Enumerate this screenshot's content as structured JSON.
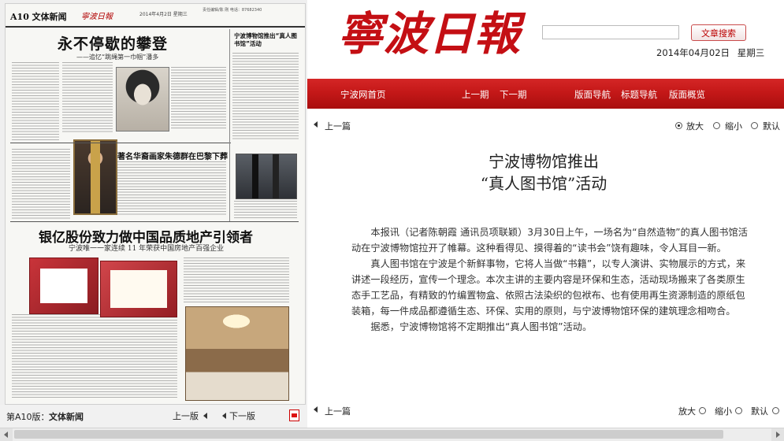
{
  "scan": {
    "section": "A10 文体新闻",
    "logo_mini": "寧波日報",
    "meta": "2014年4月2日 星期三",
    "meta2": "责任编辑/陈 刚  电话：87682340",
    "headline1": "永不停歇的攀登",
    "subhead1": "——追忆“跳绳第一巾帼”潘多",
    "headline_side": "宁波博物馆推出“真人图书馆”活动",
    "headline_mid": "著名华裔画家朱德群在巴黎下葬",
    "headline2": "银亿股份致力做中国品质地产引领者",
    "subhead2": "宁波唯一一家连续 11 年荣获中国房地产百强企业"
  },
  "left_footer": {
    "edition_prefix": "第A10版：",
    "edition_name": "文体新闻",
    "prev": "上一版",
    "next": "下一版"
  },
  "header": {
    "logo": "寧波日報",
    "search_placeholder": "",
    "search_button": "文章搜索",
    "date": "2014年04月02日",
    "weekday": "星期三"
  },
  "nav": {
    "home": "宁波网首页",
    "prev_issue": "上一期",
    "next_issue": "下一期",
    "page_nav": "版面导航",
    "title_nav": "标题导航",
    "overview": "版面概览"
  },
  "toolbar": {
    "prev_article": "上一篇",
    "zoom_in": "放大",
    "zoom_out": "缩小",
    "default": "默认",
    "selected": "zoom_in"
  },
  "toolbar_bottom": {
    "prev_article": "上一篇",
    "zoom_in": "放大",
    "zoom_out": "缩小",
    "default": "默认"
  },
  "article": {
    "title_line1": "宁波博物馆推出",
    "title_line2": "“真人图书馆”活动",
    "paragraphs": [
      "本报讯（记者陈朝霞 通讯员项联颖）3月30日上午，一场名为“自然造物”的真人图书馆活动在宁波博物馆拉开了帷幕。这种看得见、摸得着的“读书会”饶有趣味，令人耳目一新。",
      "真人图书馆在宁波是个新鲜事物，它将人当做“书籍”，以专人演讲、实物展示的方式，来讲述一段经历，宣传一个理念。本次主讲的主要内容是环保和生态，活动现场搬来了各类原生态手工艺品，有精致的竹编置物盒、依照古法染织的包袱布、也有使用再生资源制造的原纸包装箱，每一件成品都遵循生态、环保、实用的原则，与宁波博物馆环保的建筑理念相吻合。",
      "据悉，宁波博物馆将不定期推出“真人图书馆”活动。"
    ]
  },
  "colors": {
    "nav_red": "#c41818",
    "logo_red": "#c40f14",
    "search_button_text": "#bb0000"
  }
}
